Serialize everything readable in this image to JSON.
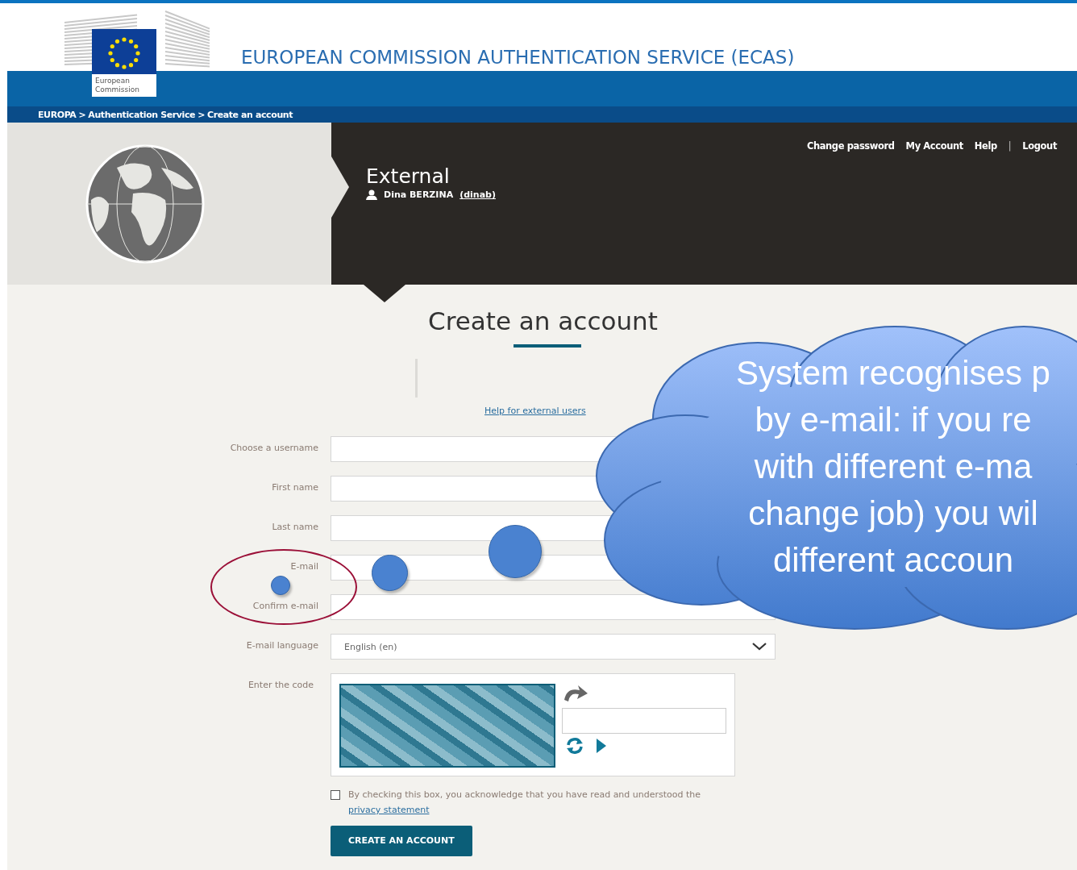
{
  "header": {
    "title": "EUROPEAN COMMISSION AUTHENTICATION SERVICE (ECAS)",
    "logo_lines": [
      "European",
      "Commission"
    ]
  },
  "breadcrumb": {
    "separator": ">",
    "items": [
      "EUROPA",
      "Authentication Service",
      "Create an account"
    ]
  },
  "user_menu": [
    {
      "kind": "link",
      "text": "Change password"
    },
    {
      "kind": "link",
      "text": "My Account"
    },
    {
      "kind": "link",
      "text": "Help"
    },
    {
      "kind": "separator",
      "text": "|"
    },
    {
      "kind": "link",
      "text": "Logout"
    }
  ],
  "hero": {
    "title": "External",
    "user_name": "Dina BERZINA",
    "user_id": "(dinab)"
  },
  "form": {
    "title": "Create an account",
    "help_link": "Help for external users",
    "fields": [
      {
        "label": "Choose a username",
        "kind": "text"
      },
      {
        "label": "First name",
        "kind": "text"
      },
      {
        "label": "Last name",
        "kind": "text"
      },
      {
        "label": "E-mail",
        "kind": "text"
      },
      {
        "label": "Confirm e-mail",
        "kind": "text"
      },
      {
        "label": "E-mail language",
        "kind": "select",
        "value": "English (en)"
      }
    ],
    "captcha": {
      "label": "Enter the code"
    },
    "consent": {
      "checked": false,
      "text": "By checking this box, you acknowledge that you have read and understood the",
      "link": "privacy statement"
    },
    "submit": "CREATE AN ACCOUNT"
  },
  "callout": {
    "lines": [
      "System recognises p",
      "by e-mail: if you re",
      "with different e-ma",
      "change job) you wil",
      "different accoun"
    ]
  }
}
